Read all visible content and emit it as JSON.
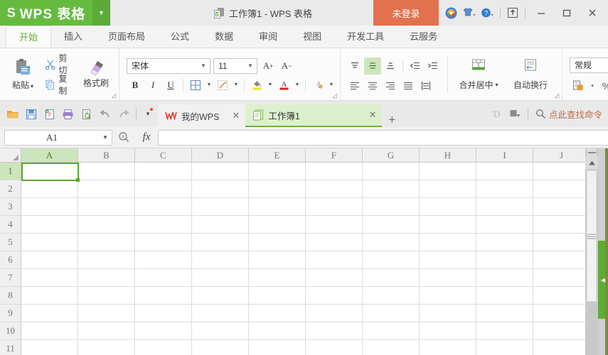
{
  "titlebar": {
    "brand": "WPS 表格",
    "brand_logo": "S",
    "brand_caret_icon": "chevron-down-icon",
    "doc_icon": "workbook-icon",
    "document_title": "工作簿1 - WPS 表格",
    "login_label": "未登录",
    "icons": [
      {
        "name": "wps-cloud-icon",
        "glyph": "◉"
      },
      {
        "name": "skin-shirt-icon",
        "glyph": "👕"
      },
      {
        "name": "help-icon",
        "glyph": "?"
      },
      {
        "name": "share-upload-icon",
        "glyph": "↥"
      }
    ],
    "window_buttons": [
      {
        "name": "minimize-button",
        "glyph": "—"
      },
      {
        "name": "maximize-button",
        "glyph": "▢"
      },
      {
        "name": "close-button",
        "glyph": "✕"
      }
    ]
  },
  "menubar": {
    "items": [
      {
        "label": "开始",
        "active": true
      },
      {
        "label": "插入",
        "active": false
      },
      {
        "label": "页面布局",
        "active": false
      },
      {
        "label": "公式",
        "active": false
      },
      {
        "label": "数据",
        "active": false
      },
      {
        "label": "审阅",
        "active": false
      },
      {
        "label": "视图",
        "active": false
      },
      {
        "label": "开发工具",
        "active": false
      },
      {
        "label": "云服务",
        "active": false
      }
    ]
  },
  "ribbon": {
    "clipboard": {
      "paste_label": "粘贴",
      "paste_caret": "▾",
      "cut_label": "剪切",
      "copy_label": "复制",
      "format_painter_label": "格式刷"
    },
    "font": {
      "font_name": "宋体",
      "font_size": "11",
      "grow_font": "A",
      "grow_font_sup": "+",
      "shrink_font": "A",
      "shrink_font_sup": "−",
      "bold": "B",
      "italic": "I",
      "underline": "U",
      "borders_icon": "borders-icon",
      "draw_border_icon": "draw-border-icon",
      "fill_color_icon": "fill-color-icon",
      "font_color_icon": "font-color-icon",
      "clear_format_icon": "clear-format-icon"
    },
    "alignment": {
      "align_top_icon": "align-top-icon",
      "align_middle_icon": "align-middle-icon",
      "align_bottom_icon": "align-bottom-icon",
      "decrease_indent_icon": "decrease-indent-icon",
      "increase_indent_icon": "increase-indent-icon",
      "align_left_icon": "align-left-icon",
      "align_center_icon": "align-center-icon",
      "align_right_icon": "align-right-icon",
      "justify_icon": "justify-icon",
      "distribute_icon": "distribute-icon",
      "merge_center_label": "合并居中",
      "merge_center_caret": "▾",
      "wrap_text_label": "自动换行"
    },
    "number": {
      "format_value": "常规",
      "accounting_icon": "accounting-format-icon",
      "accounting_caret": "▾",
      "percent_label": "%"
    },
    "overflow_caret": "›"
  },
  "quickaccess": {
    "items": [
      {
        "name": "open-icon",
        "title": "打开"
      },
      {
        "name": "save-icon",
        "title": "保存"
      },
      {
        "name": "print-preview-save-icon",
        "title": "输出PDF"
      },
      {
        "name": "print-icon",
        "title": "打印"
      },
      {
        "name": "print-preview-icon",
        "title": "打印预览"
      },
      {
        "name": "undo-icon",
        "title": "撤销"
      },
      {
        "name": "redo-icon",
        "title": "恢复"
      }
    ],
    "customize_caret": "▾"
  },
  "doctabs": {
    "tabs": [
      {
        "label": "我的WPS",
        "icon": "wps-w-icon",
        "active": false,
        "close": "✕"
      },
      {
        "label": "工作簿1",
        "icon": "workbook-icon",
        "active": true,
        "close": "✕"
      }
    ],
    "new_tab": "+",
    "right_icons": [
      {
        "name": "ime-icon",
        "glyph": "Ɗ"
      },
      {
        "name": "backup-icon",
        "glyph": "▤"
      }
    ],
    "search_icon": "search-icon",
    "search_label": "点此查找命令"
  },
  "formulabar": {
    "name_box_value": "A1",
    "name_box_caret": "▾",
    "zoom_icon": "zoom-name-icon",
    "fx_label": "fx",
    "formula_value": ""
  },
  "grid": {
    "select_all_icon": "select-all-corner-icon",
    "columns": [
      "A",
      "B",
      "C",
      "D",
      "E",
      "F",
      "G",
      "H",
      "I",
      "J"
    ],
    "rows": [
      "1",
      "2",
      "3",
      "4",
      "5",
      "6",
      "7",
      "8",
      "9",
      "10",
      "11"
    ],
    "active_cell": "A1",
    "cells": {}
  },
  "scrollbar": {
    "split_handle": "split-handle",
    "up_arrow": "▲",
    "thumb": "vscroll-thumb"
  },
  "taskpane": {
    "toggle_icon": "collapse-pane-arrow-icon",
    "toggle_glyph": "◀"
  },
  "colors": {
    "brand_green": "#66bb3f",
    "login_orange": "#e2714e",
    "tab_active_green": "#ddf0cd",
    "selection_green": "#5aa634",
    "header_green": "#cde5bd",
    "pane_green": "#5eac36",
    "find_text": "#c06a45"
  }
}
